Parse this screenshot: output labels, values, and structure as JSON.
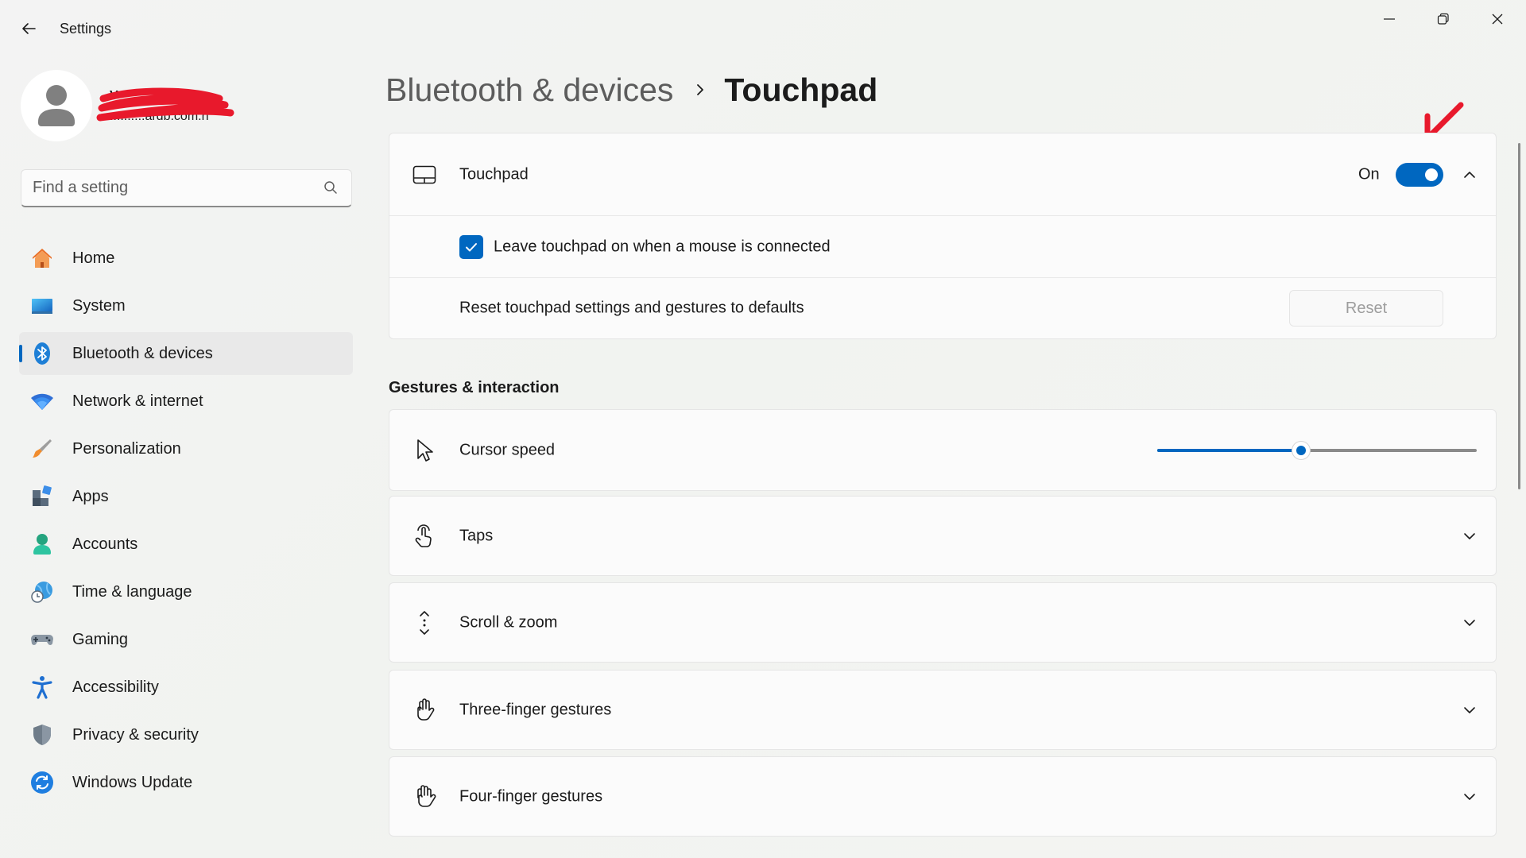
{
  "window": {
    "title": "Settings",
    "back_icon": "back-arrow-icon",
    "controls": [
      "minimize-icon",
      "maximize-icon",
      "close-icon"
    ]
  },
  "profile": {
    "name": "V",
    "email": "..........ardb.com.h",
    "avatar_icon": "person-icon",
    "redacted": true
  },
  "search": {
    "placeholder": "Find a setting",
    "value": "",
    "icon": "search-icon"
  },
  "sidebar": {
    "items": [
      {
        "label": "Home",
        "icon": "home-icon",
        "active": false
      },
      {
        "label": "System",
        "icon": "monitor-icon",
        "active": false
      },
      {
        "label": "Bluetooth & devices",
        "icon": "bluetooth-icon",
        "active": true
      },
      {
        "label": "Network & internet",
        "icon": "wifi-icon",
        "active": false
      },
      {
        "label": "Personalization",
        "icon": "brush-icon",
        "active": false
      },
      {
        "label": "Apps",
        "icon": "apps-icon",
        "active": false
      },
      {
        "label": "Accounts",
        "icon": "accounts-icon",
        "active": false
      },
      {
        "label": "Time & language",
        "icon": "globe-clock-icon",
        "active": false
      },
      {
        "label": "Gaming",
        "icon": "gamepad-icon",
        "active": false
      },
      {
        "label": "Accessibility",
        "icon": "accessibility-icon",
        "active": false
      },
      {
        "label": "Privacy & security",
        "icon": "shield-icon",
        "active": false
      },
      {
        "label": "Windows Update",
        "icon": "update-icon",
        "active": false
      }
    ]
  },
  "breadcrumb": {
    "parent": "Bluetooth & devices",
    "current": "Touchpad"
  },
  "touchpad_card": {
    "label": "Touchpad",
    "toggle_state": "On",
    "toggle_on": true,
    "expanded": true,
    "leave_on_label": "Leave touchpad on when a mouse is connected",
    "leave_on_checked": true,
    "reset_label": "Reset touchpad settings and gestures to defaults",
    "reset_button": "Reset"
  },
  "gestures": {
    "title": "Gestures & interaction",
    "cursor_speed": {
      "label": "Cursor speed",
      "value_fraction": 0.45
    },
    "expanders": [
      {
        "label": "Taps",
        "icon": "tap-icon"
      },
      {
        "label": "Scroll & zoom",
        "icon": "scroll-icon"
      },
      {
        "label": "Three-finger gestures",
        "icon": "hand-icon"
      },
      {
        "label": "Four-finger gestures",
        "icon": "hand-icon"
      }
    ]
  },
  "colors": {
    "accent": "#0067c0",
    "annotation_arrow": "#e8192c"
  }
}
